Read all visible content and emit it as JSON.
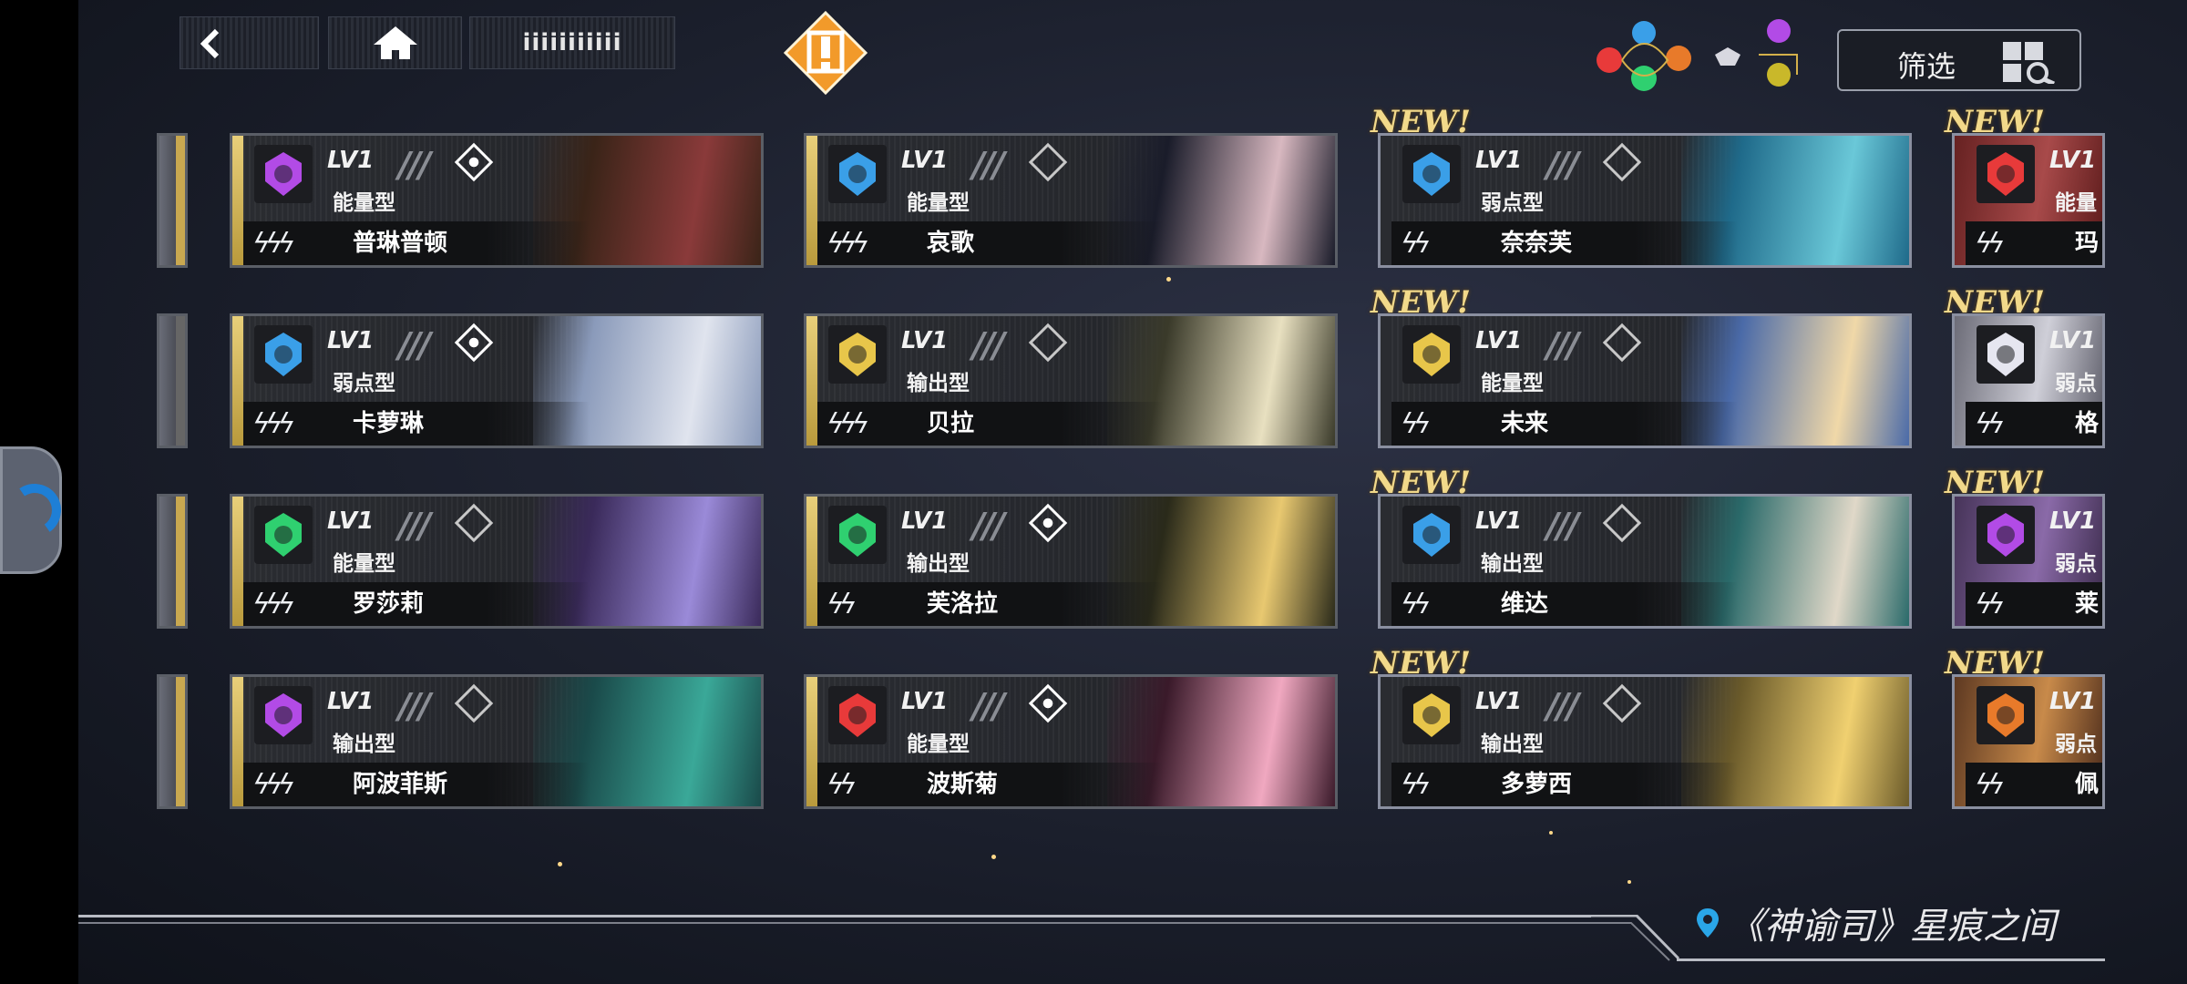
{
  "topbar": {
    "back_icon": "chevron-left-icon",
    "home_icon": "home-icon",
    "title": "iiiiiiiiiii",
    "alert_icon": "exclamation-icon"
  },
  "filter": {
    "label": "筛选",
    "icon": "grid-search-icon",
    "element_icons": [
      "blue-crest",
      "purple-crown",
      "red-wolf",
      "orange-gem",
      "green-tree",
      "white-wings",
      "yellow-chalice"
    ]
  },
  "colors": {
    "purple": "#b24be6",
    "blue": "#3a9fe8",
    "green": "#2fd070",
    "gold": "#e8c64a",
    "red": "#e83a3a",
    "orange": "#e87a2a",
    "white": "#e6e6f0",
    "new_tag": "#f2d98a",
    "location_pin": "#2aa6e8"
  },
  "new_label": "NEW!",
  "cards": [
    {
      "lv": "LV1",
      "type": "能量型",
      "name": "普琳普顿",
      "bolts": "ϟϟϟ",
      "element": "purple-crown",
      "new": false,
      "diamond_lit": true
    },
    {
      "lv": "LV1",
      "type": "能量型",
      "name": "哀歌",
      "bolts": "ϟϟϟ",
      "element": "blue-crest",
      "new": false,
      "diamond_lit": false
    },
    {
      "lv": "LV1",
      "type": "弱点型",
      "name": "奈奈芙",
      "bolts": "ϟϟ",
      "element": "blue-crest",
      "new": true,
      "diamond_lit": false
    },
    {
      "lv": "LV1",
      "type": "能量",
      "name": "玛",
      "bolts": "ϟϟ",
      "element": "red-wolf",
      "new": true,
      "diamond_lit": false
    },
    {
      "lv": "LV1",
      "type": "弱点型",
      "name": "卡萝琳",
      "bolts": "ϟϟϟ",
      "element": "blue-crest",
      "new": false,
      "diamond_lit": true
    },
    {
      "lv": "LV1",
      "type": "输出型",
      "name": "贝拉",
      "bolts": "ϟϟϟ",
      "element": "gold-chalice",
      "new": false,
      "diamond_lit": false
    },
    {
      "lv": "LV1",
      "type": "能量型",
      "name": "未来",
      "bolts": "ϟϟ",
      "element": "gold-chalice",
      "new": true,
      "diamond_lit": false
    },
    {
      "lv": "LV1",
      "type": "弱点",
      "name": "格",
      "bolts": "ϟϟ",
      "element": "white-wings",
      "new": true,
      "diamond_lit": false
    },
    {
      "lv": "LV1",
      "type": "能量型",
      "name": "罗莎莉",
      "bolts": "ϟϟϟ",
      "element": "green-tree",
      "new": false,
      "diamond_lit": false
    },
    {
      "lv": "LV1",
      "type": "输出型",
      "name": "芙洛拉",
      "bolts": "ϟϟ",
      "element": "green-tree",
      "new": false,
      "diamond_lit": true
    },
    {
      "lv": "LV1",
      "type": "输出型",
      "name": "维达",
      "bolts": "ϟϟ",
      "element": "blue-crest",
      "new": true,
      "diamond_lit": false
    },
    {
      "lv": "LV1",
      "type": "弱点",
      "name": "莱",
      "bolts": "ϟϟ",
      "element": "purple-crown",
      "new": true,
      "diamond_lit": false
    },
    {
      "lv": "LV1",
      "type": "输出型",
      "name": "阿波菲斯",
      "bolts": "ϟϟϟ",
      "element": "purple-crown",
      "new": false,
      "diamond_lit": false
    },
    {
      "lv": "LV1",
      "type": "能量型",
      "name": "波斯菊",
      "bolts": "ϟϟ",
      "element": "red-wolf",
      "new": false,
      "diamond_lit": true
    },
    {
      "lv": "LV1",
      "type": "输出型",
      "name": "多萝西",
      "bolts": "ϟϟ",
      "element": "gold-chalice",
      "new": true,
      "diamond_lit": false
    },
    {
      "lv": "LV1",
      "type": "弱点",
      "name": "佩",
      "bolts": "ϟϟ",
      "element": "orange-beast",
      "new": true,
      "diamond_lit": false
    }
  ],
  "footer": {
    "location": "《神谕司》星痕之间",
    "pin_icon": "map-pin-icon"
  }
}
